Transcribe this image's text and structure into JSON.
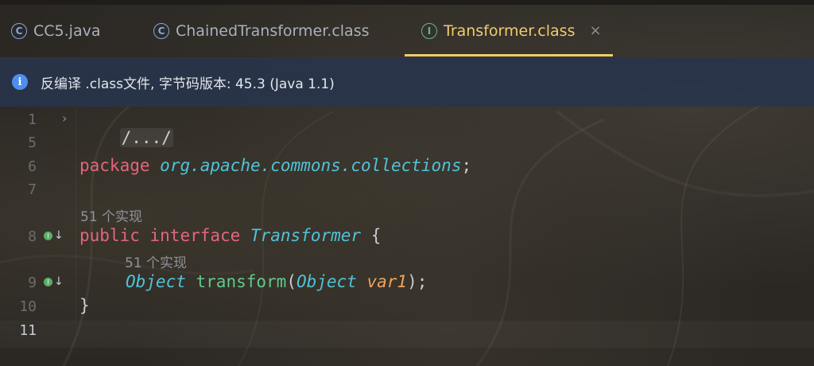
{
  "tabs": [
    {
      "label": "CC5.java",
      "icon": "class-icon",
      "active": false
    },
    {
      "label": "ChainedTransformer.class",
      "icon": "class-icon",
      "active": false
    },
    {
      "label": "Transformer.class",
      "icon": "interface-icon",
      "active": true,
      "close": "×"
    }
  ],
  "tab_icon_letters": {
    "class": "C",
    "interface": "I"
  },
  "banner": {
    "icon": "info-icon",
    "text": "反编译 .class文件, 字节码版本: 45.3 (Java 1.1)"
  },
  "editor": {
    "line_numbers": [
      "1",
      "5",
      "6",
      "7",
      "8",
      "9",
      "10",
      "11"
    ],
    "fold_text": "/.../",
    "package_kw": "package",
    "package_name": "org.apache.commons.collections",
    "semicolon": ";",
    "hint_interface": "51 个实现",
    "public_kw": "public",
    "interface_kw": "interface",
    "interface_name": "Transformer",
    "open_brace": "{",
    "hint_method": "51 个实现",
    "ret_type": "Object",
    "method_name": "transform",
    "paren_open": "(",
    "param_type": "Object",
    "param_name": "var1",
    "paren_close": ");",
    "close_brace": "}",
    "impl_marker": "I",
    "impl_arrow": "↓",
    "fold_chevron": "›"
  },
  "colors": {
    "active_tab": "#f0cb6e",
    "keyword": "#e3667e",
    "type": "#4fc3d8",
    "function": "#5fc98c",
    "param": "#f0a35c",
    "banner_bg": "#28344c"
  }
}
